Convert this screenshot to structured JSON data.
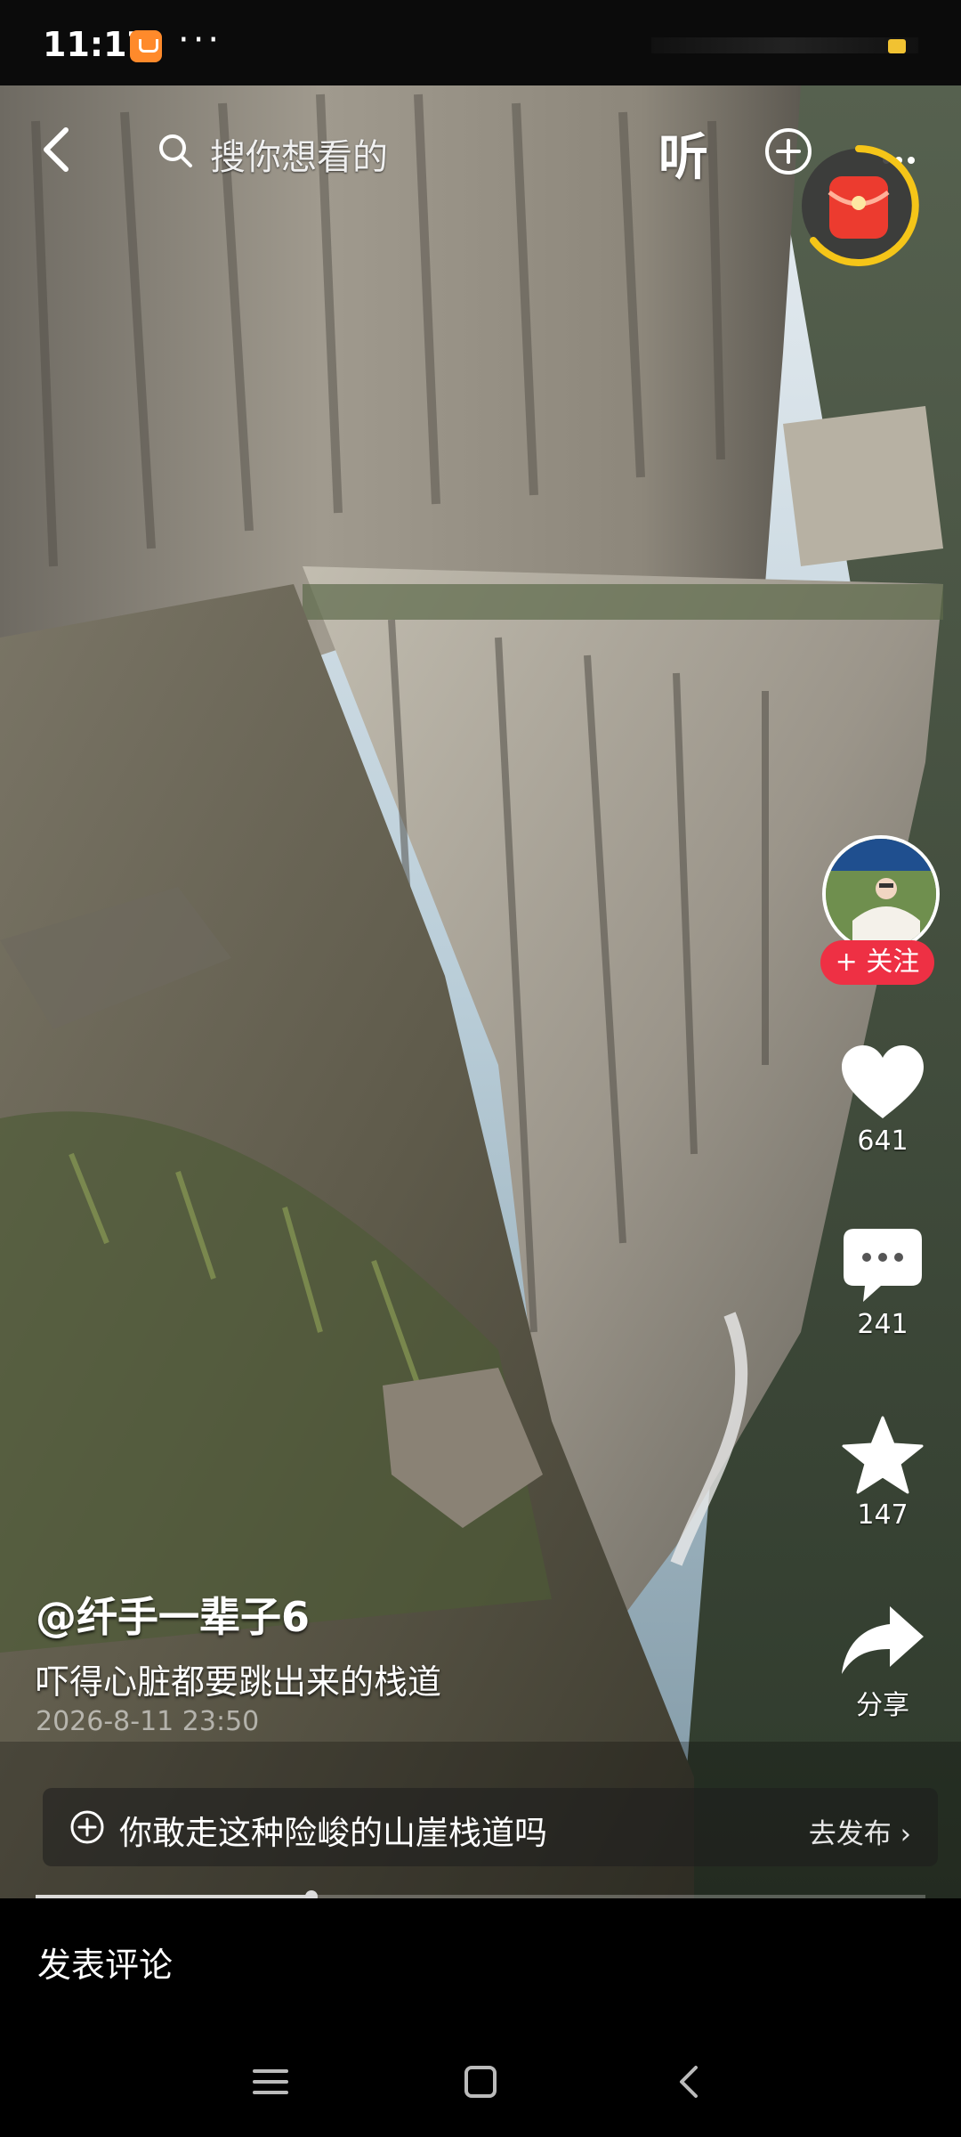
{
  "status_bar": {
    "time": "11:17",
    "dots": "···"
  },
  "top_bar": {
    "search_placeholder": "搜你想看的",
    "listen_label": "听"
  },
  "author": {
    "handle": "@纤手一辈子6"
  },
  "post": {
    "caption": "吓得心脏都要跳出来的栈道",
    "date": "2026-8-11 23:50"
  },
  "actions": {
    "follow_label": "+ 关注",
    "likes": "641",
    "comments": "241",
    "favorites": "147",
    "share_label": "分享"
  },
  "topic": {
    "text": "你敢走这种险峻的山崖栈道吗",
    "action": "去发布 ›"
  },
  "progress": {
    "fraction": 0.31
  },
  "comment_bar": {
    "placeholder": "发表评论"
  },
  "icons": [
    "back-icon",
    "search-icon",
    "plus-circle-icon",
    "more-icon",
    "red-packet-icon",
    "heart-icon",
    "comment-icon",
    "star-icon",
    "share-icon",
    "plus-circle-icon",
    "menu-icon",
    "home-icon",
    "back-nav-icon"
  ]
}
